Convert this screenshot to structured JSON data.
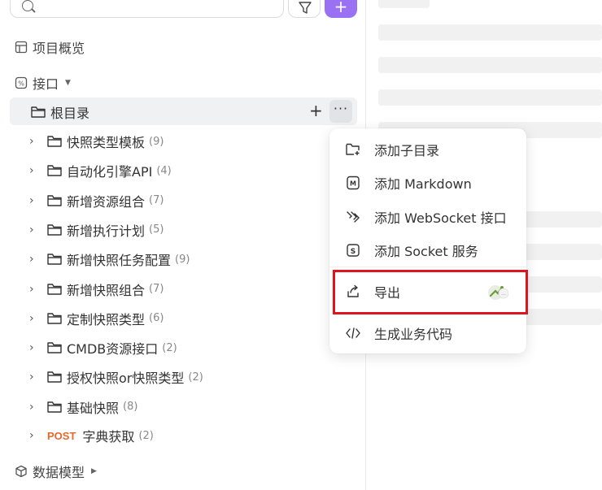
{
  "sidebar": {
    "overview_label": "项目概览",
    "api_label": "接口",
    "root_label": "根目录",
    "items": [
      {
        "label": "快照类型模板",
        "count": "(9)"
      },
      {
        "label": "自动化引擎API",
        "count": "(4)"
      },
      {
        "label": "新增资源组合",
        "count": "(7)"
      },
      {
        "label": "新增执行计划",
        "count": "(5)"
      },
      {
        "label": "新增快照任务配置",
        "count": "(9)"
      },
      {
        "label": "新增快照组合",
        "count": "(7)"
      },
      {
        "label": "定制快照类型",
        "count": "(6)"
      },
      {
        "label": "CMDB资源接口",
        "count": "(2)"
      },
      {
        "label": "授权快照or快照类型",
        "count": "(2)"
      },
      {
        "label": "基础快照",
        "count": "(8)"
      }
    ],
    "post_item": {
      "method": "POST",
      "label": "字典获取",
      "count": "(2)"
    },
    "data_model_label": "数据模型"
  },
  "toolbar": {
    "add_symbol": "+"
  },
  "root_actions": {
    "add_symbol": "+",
    "more_symbol": "···"
  },
  "menu": {
    "items": [
      {
        "label": "添加子目录"
      },
      {
        "label": "添加 Markdown"
      },
      {
        "label": "添加 WebSocket 接口"
      },
      {
        "label": "添加 Socket 服务"
      },
      {
        "label": "导出"
      },
      {
        "label": "生成业务代码"
      }
    ]
  },
  "colors": {
    "accent": "#9b71f4",
    "post": "#e8672b",
    "highlight": "#e0141e"
  }
}
